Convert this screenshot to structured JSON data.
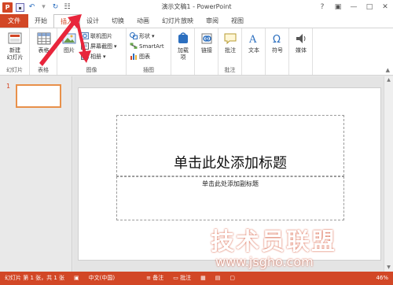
{
  "window": {
    "title": "演示文稿1 - PowerPoint",
    "controls": [
      "?",
      "▣",
      "—",
      "□",
      "✕"
    ]
  },
  "quick_access": {
    "logo": "P",
    "icons": [
      "save-icon",
      "undo-icon",
      "redo-icon",
      "repeat-icon"
    ]
  },
  "tabs": [
    {
      "label": "文件"
    },
    {
      "label": "开始"
    },
    {
      "label": "插入"
    },
    {
      "label": "设计"
    },
    {
      "label": "切换"
    },
    {
      "label": "动画"
    },
    {
      "label": "幻灯片放映"
    },
    {
      "label": "审阅"
    },
    {
      "label": "视图"
    }
  ],
  "ribbon": {
    "groups": {
      "slides": {
        "label": "幻灯片",
        "new_slide": "新建\n幻灯片"
      },
      "tables": {
        "label": "表格",
        "table": "表格"
      },
      "images": {
        "label": "图像",
        "picture": "图片",
        "online_picture": "联机图片",
        "screenshot": "屏幕截图",
        "album": "相册"
      },
      "illustrations": {
        "label": "插图",
        "shapes": "形状",
        "smartart": "SmartArt",
        "chart": "图表"
      },
      "apps": {
        "label": "加载\n项"
      },
      "links": {
        "label": "链接"
      },
      "comments": {
        "label": "批注",
        "comment": "批注"
      },
      "text": {
        "label": "文本"
      },
      "symbols": {
        "label": "符号"
      },
      "media": {
        "label": "媒体"
      }
    }
  },
  "thumbnails": {
    "number": "1"
  },
  "slide": {
    "title_placeholder": "单击此处添加标题",
    "subtitle_placeholder": "单击此处添加副标题"
  },
  "status": {
    "slide_info": "幻灯片 第 1 张，共 1 张",
    "language": "中文(中国)",
    "notes": "备注",
    "comments": "批注",
    "zoom": "46%"
  },
  "watermark": {
    "big": "技术员联盟",
    "small": "www.jsgho.com"
  },
  "colors": {
    "accent": "#d24726"
  }
}
